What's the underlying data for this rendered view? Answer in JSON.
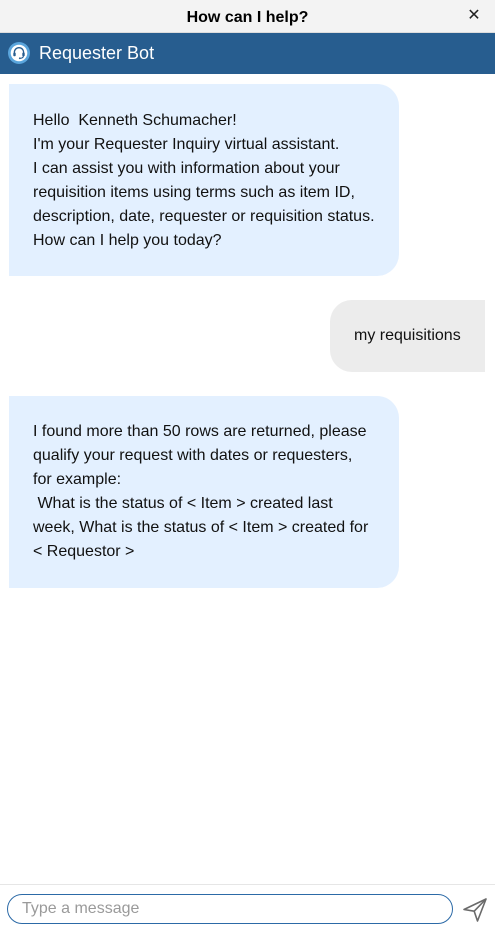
{
  "window": {
    "title": "How can I help?",
    "close_glyph": "✕"
  },
  "header": {
    "bot_name": "Requester Bot",
    "icon": "headset-bot-icon",
    "background": "#275d8f"
  },
  "messages": [
    {
      "from": "bot",
      "lines": [
        "Hello  Kenneth Schumacher!",
        "I'm your Requester Inquiry virtual assistant.",
        "I can assist you with information about your",
        "requisition items using terms such as item ID,",
        "description, date, requester or requisition status.",
        "How can I help you today?"
      ]
    },
    {
      "from": "user",
      "lines": [
        "my requisitions"
      ]
    },
    {
      "from": "bot",
      "lines": [
        "I found more than 50 rows are returned, please",
        "qualify your request with dates or requesters,",
        "for example:",
        " What is the status of < Item > created last",
        "week, What is the status of < Item > created for",
        "< Requestor >"
      ]
    }
  ],
  "composer": {
    "placeholder": "Type a message",
    "value": "",
    "send_icon": "send-icon"
  },
  "colors": {
    "bot_bubble": "#e3f0ff",
    "user_bubble": "#ececec",
    "input_border": "#2c6aa7"
  }
}
